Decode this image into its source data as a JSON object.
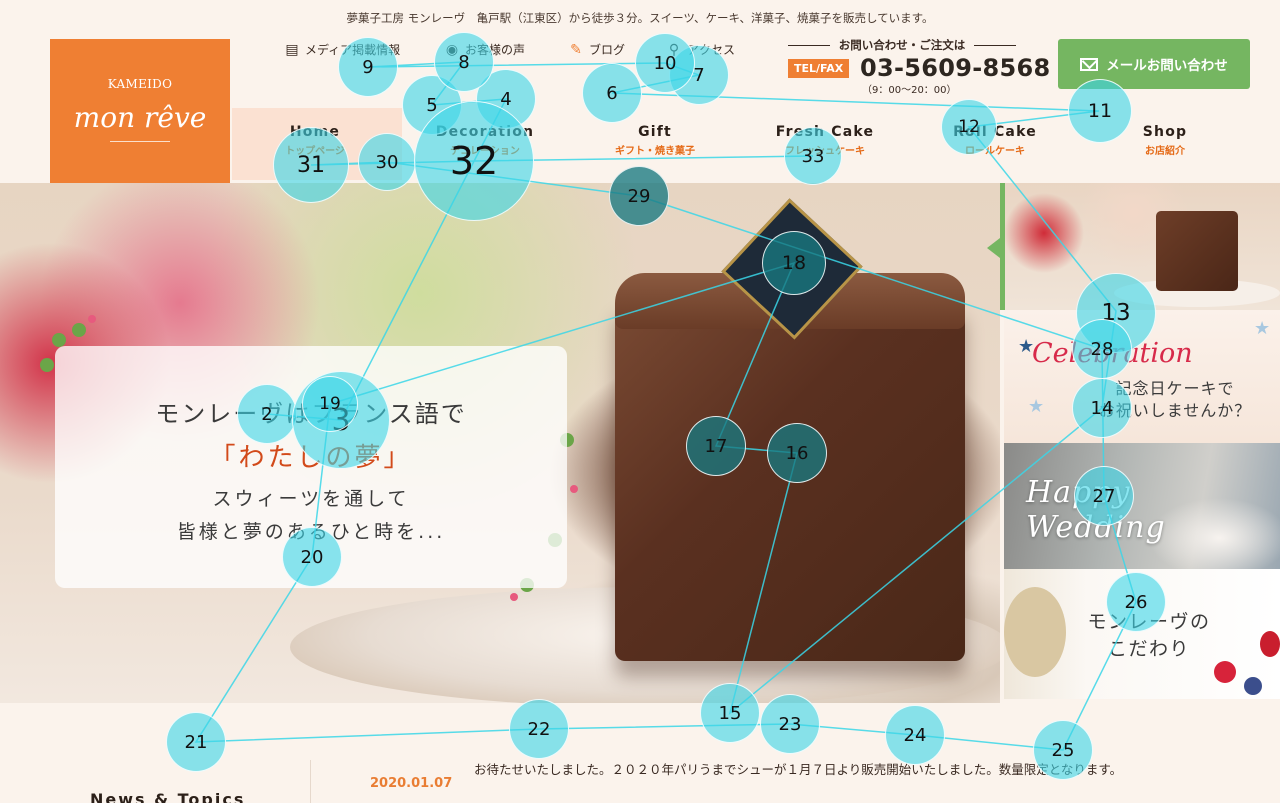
{
  "tagline": "夢菓子工房 モンレーヴ　亀戸駅（江東区）から徒歩３分。スイーツ、ケーキ、洋菓子、焼菓子を販売しています。",
  "logo": {
    "top": "KAMEIDO",
    "script": "mon rêve"
  },
  "util_links": [
    {
      "label": "メディア掲載情報",
      "icon": "newspaper-icon"
    },
    {
      "label": "お客様の声",
      "icon": "speech-bubble-icon"
    },
    {
      "label": "ブログ",
      "icon": "pencil-icon"
    },
    {
      "label": "アクセス",
      "icon": "map-pin-icon"
    }
  ],
  "contact": {
    "heading": "お問い合わせ・ご注文は",
    "tel_label": "TEL/FAX",
    "tel_number": "03-5609-8568",
    "hours": "（9：00～20：00）"
  },
  "mail_button": {
    "label": "メールお問い合わせ",
    "icon": "envelope-icon"
  },
  "nav": [
    {
      "en": "Home",
      "ja": "トップページ"
    },
    {
      "en": "Decoration",
      "ja": "デコレーション"
    },
    {
      "en": "Gift",
      "ja": "ギフト・焼き菓子"
    },
    {
      "en": "Fresh Cake",
      "ja": "フレッシュケーキ"
    },
    {
      "en": "Roll Cake",
      "ja": "ロールケーキ"
    },
    {
      "en": "Shop",
      "ja": "お店紹介"
    }
  ],
  "hero": {
    "line1": "モンレーヴはフランス語で",
    "line2": "「わたしの夢」",
    "line3": "スウィーツを通して",
    "line4": "皆様と夢のあるひと時を..."
  },
  "side_banners": [
    {
      "title": ""
    },
    {
      "title": "Celebration",
      "sub1": "記念日ケーキで",
      "sub2": "お祝いしませんか？"
    },
    {
      "title": "Happy Wedding"
    },
    {
      "line1": "モンレーヴの",
      "line2": "こだわり"
    }
  ],
  "news": {
    "heading": "News & Topics",
    "date": "2020.01.07",
    "text": "お待たせいたしました。２０２０年パリうまでシューが１月７日より販売開始いたしました。数量限定となります。"
  },
  "colors": {
    "accent_orange": "#ef7f33",
    "accent_green": "#75b661",
    "marker_cyan": "#3ad6e8",
    "marker_dark": "#187880",
    "heart_red": "#d72a4a"
  },
  "overlay": {
    "markers": [
      {
        "n": "2"
      },
      {
        "n": "3"
      },
      {
        "n": "4"
      },
      {
        "n": "5"
      },
      {
        "n": "6"
      },
      {
        "n": "7"
      },
      {
        "n": "8"
      },
      {
        "n": "9"
      },
      {
        "n": "10"
      },
      {
        "n": "11"
      },
      {
        "n": "12"
      },
      {
        "n": "13"
      },
      {
        "n": "14"
      },
      {
        "n": "15"
      },
      {
        "n": "16"
      },
      {
        "n": "17"
      },
      {
        "n": "18"
      },
      {
        "n": "19"
      },
      {
        "n": "20"
      },
      {
        "n": "21"
      },
      {
        "n": "22"
      },
      {
        "n": "23"
      },
      {
        "n": "24"
      },
      {
        "n": "25"
      },
      {
        "n": "26"
      },
      {
        "n": "27"
      },
      {
        "n": "28"
      },
      {
        "n": "29"
      },
      {
        "n": "30"
      },
      {
        "n": "31"
      },
      {
        "n": "32"
      },
      {
        "n": "33"
      }
    ]
  }
}
